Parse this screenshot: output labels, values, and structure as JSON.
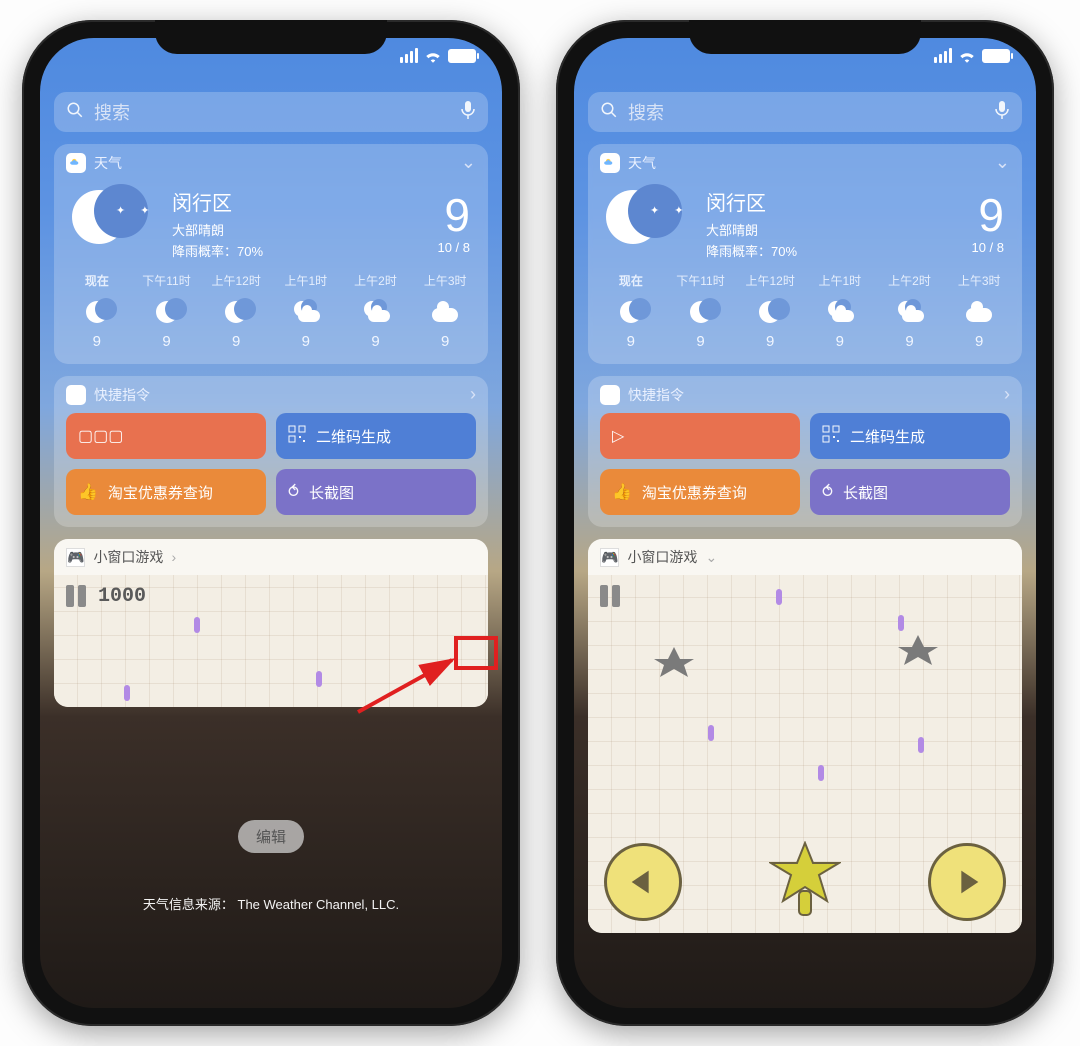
{
  "search": {
    "placeholder": "搜索"
  },
  "weather": {
    "title": "天气",
    "location": "闵行区",
    "condition": "大部晴朗",
    "rain_label": "降雨概率：",
    "rain_value": "70%",
    "temp": "9",
    "range": "10 / 8",
    "hours": [
      {
        "label": "现在",
        "icon": "moon",
        "temp": "9",
        "now": true
      },
      {
        "label": "下午11时",
        "icon": "moon",
        "temp": "9"
      },
      {
        "label": "上午12时",
        "icon": "moon",
        "temp": "9"
      },
      {
        "label": "上午1时",
        "icon": "cloud-moon",
        "temp": "9"
      },
      {
        "label": "上午2时",
        "icon": "cloud-moon",
        "temp": "9"
      },
      {
        "label": "上午3时",
        "icon": "cloud",
        "temp": "9"
      }
    ]
  },
  "shortcuts": {
    "title": "快捷指令",
    "items": [
      {
        "label": "",
        "icon": "play3",
        "color": "sc-orange"
      },
      {
        "label": "二维码生成",
        "icon": "qr",
        "color": "sc-blue"
      },
      {
        "label": "淘宝优惠券查询",
        "icon": "thumb",
        "color": "sc-orange2"
      },
      {
        "label": "长截图",
        "icon": "loop",
        "color": "sc-purple"
      }
    ]
  },
  "shortcuts_right": {
    "items": [
      {
        "label": "",
        "icon": "play1",
        "color": "sc-orange"
      },
      {
        "label": "二维码生成",
        "icon": "qr",
        "color": "sc-blue"
      },
      {
        "label": "淘宝优惠券查询",
        "icon": "thumb",
        "color": "sc-orange2"
      },
      {
        "label": "长截图",
        "icon": "loop",
        "color": "sc-purple"
      }
    ]
  },
  "game": {
    "title": "小窗口游戏",
    "score": "1000"
  },
  "edit_label": "编辑",
  "attribution_prefix": "天气信息来源：",
  "attribution_source": "The Weather Channel, LLC."
}
